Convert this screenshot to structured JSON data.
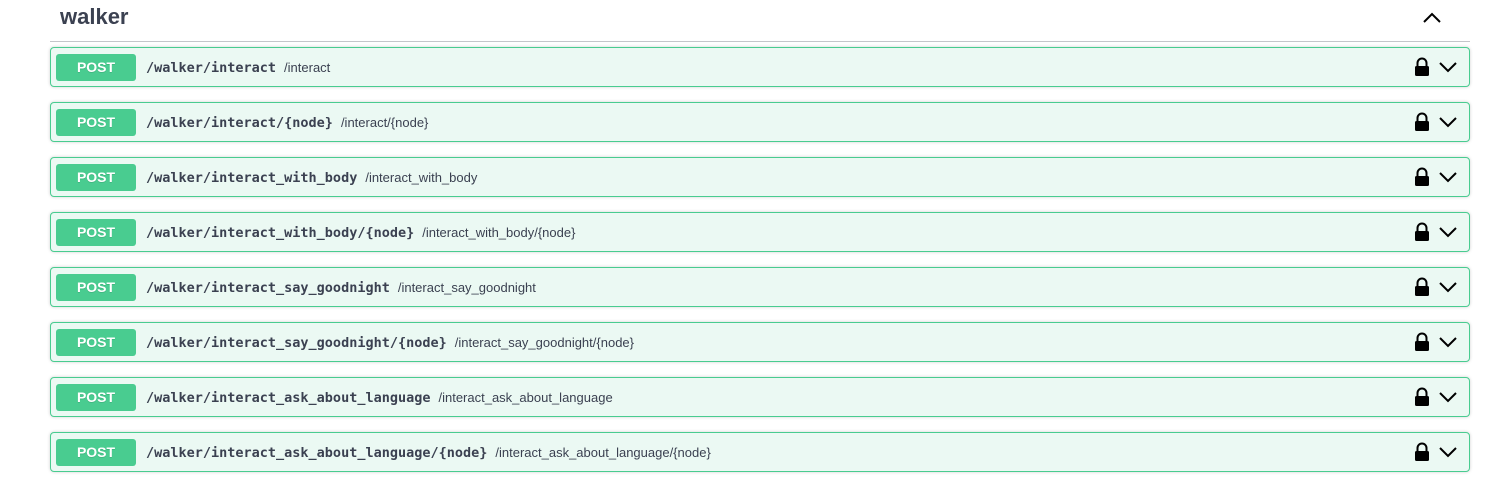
{
  "tag": {
    "name": "walker"
  },
  "operations": [
    {
      "method": "POST",
      "path": "/walker/interact",
      "summary": "/interact"
    },
    {
      "method": "POST",
      "path": "/walker/interact/{node}",
      "summary": "/interact/{node}"
    },
    {
      "method": "POST",
      "path": "/walker/interact_with_body",
      "summary": "/interact_with_body"
    },
    {
      "method": "POST",
      "path": "/walker/interact_with_body/{node}",
      "summary": "/interact_with_body/{node}"
    },
    {
      "method": "POST",
      "path": "/walker/interact_say_goodnight",
      "summary": "/interact_say_goodnight"
    },
    {
      "method": "POST",
      "path": "/walker/interact_say_goodnight/{node}",
      "summary": "/interact_say_goodnight/{node}"
    },
    {
      "method": "POST",
      "path": "/walker/interact_ask_about_language",
      "summary": "/interact_ask_about_language"
    },
    {
      "method": "POST",
      "path": "/walker/interact_ask_about_language/{node}",
      "summary": "/interact_ask_about_language/{node}"
    }
  ],
  "colors": {
    "post_accent": "#49cc90",
    "post_bg": "#ebf9f3",
    "text": "#3b4151"
  },
  "icons": {
    "collapse": "chevron-up-icon",
    "lock": "lock-icon",
    "expand": "chevron-down-icon"
  }
}
